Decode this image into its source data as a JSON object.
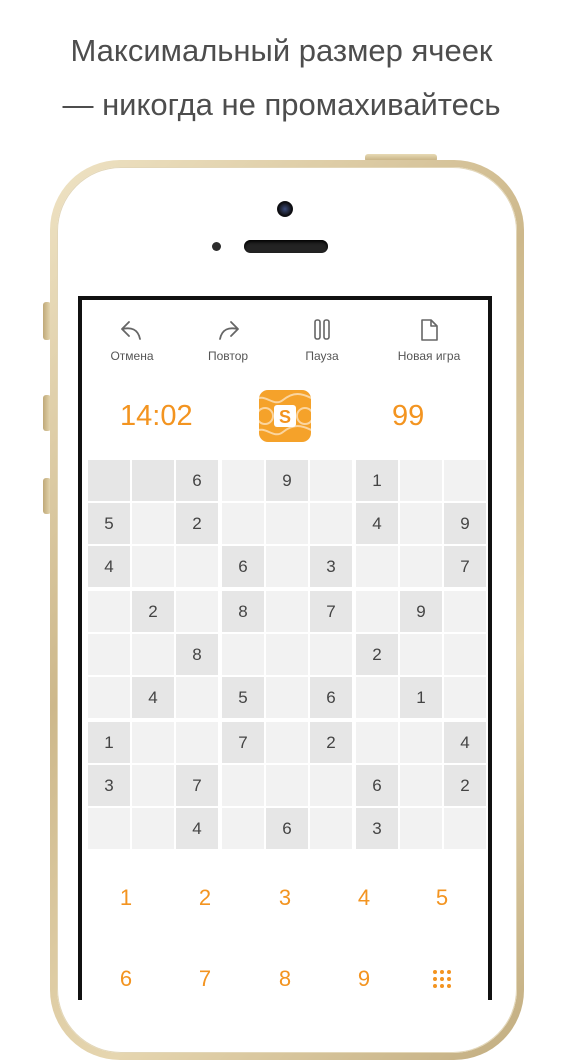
{
  "headline": {
    "line1": "Максимальный размер ячеек",
    "line2": "— никогда не промахивайтесь"
  },
  "toolbar": {
    "undo_label": "Отмена",
    "redo_label": "Повтор",
    "pause_label": "Пауза",
    "new_game_label": "Новая игра"
  },
  "status": {
    "timer": "14:02",
    "score": "99",
    "logo_letter": "S"
  },
  "colors": {
    "accent": "#f39420",
    "cell_light": "#f2f2f2",
    "cell_given": "#e6e6e6"
  },
  "board": [
    [
      "",
      "",
      "6",
      "",
      "9",
      "",
      "1",
      "",
      ""
    ],
    [
      "5",
      "",
      "2",
      "",
      "",
      "",
      "4",
      "",
      "9"
    ],
    [
      "4",
      "",
      "",
      "6",
      "",
      "3",
      "",
      "",
      "7"
    ],
    [
      "",
      "2",
      "",
      "8",
      "",
      "7",
      "",
      "9",
      ""
    ],
    [
      "",
      "",
      "8",
      "",
      "",
      "",
      "2",
      "",
      ""
    ],
    [
      "",
      "4",
      "",
      "5",
      "",
      "6",
      "",
      "1",
      ""
    ],
    [
      "1",
      "",
      "",
      "7",
      "",
      "2",
      "",
      "",
      "4"
    ],
    [
      "3",
      "",
      "7",
      "",
      "",
      "",
      "6",
      "",
      "2"
    ],
    [
      "",
      "",
      "4",
      "",
      "6",
      "",
      "3",
      "",
      ""
    ]
  ],
  "highlighted_cells": [
    [
      0,
      0
    ],
    [
      0,
      1
    ],
    [
      0,
      2
    ],
    [
      0,
      4
    ],
    [
      0,
      6
    ],
    [
      1,
      0
    ],
    [
      1,
      2
    ],
    [
      1,
      6
    ],
    [
      1,
      8
    ],
    [
      2,
      0
    ],
    [
      2,
      3
    ],
    [
      2,
      5
    ],
    [
      2,
      8
    ],
    [
      3,
      1
    ],
    [
      3,
      3
    ],
    [
      3,
      5
    ],
    [
      3,
      7
    ],
    [
      4,
      2
    ],
    [
      4,
      6
    ],
    [
      5,
      1
    ],
    [
      5,
      3
    ],
    [
      5,
      5
    ],
    [
      5,
      7
    ],
    [
      6,
      0
    ],
    [
      6,
      3
    ],
    [
      6,
      5
    ],
    [
      6,
      8
    ],
    [
      7,
      0
    ],
    [
      7,
      2
    ],
    [
      7,
      6
    ],
    [
      7,
      8
    ],
    [
      8,
      2
    ],
    [
      8,
      4
    ],
    [
      8,
      6
    ]
  ],
  "keypad": {
    "row1": [
      "1",
      "2",
      "3",
      "4",
      "5"
    ],
    "row2": [
      "6",
      "7",
      "8",
      "9"
    ],
    "extra_icon": "grid-dots-icon"
  }
}
